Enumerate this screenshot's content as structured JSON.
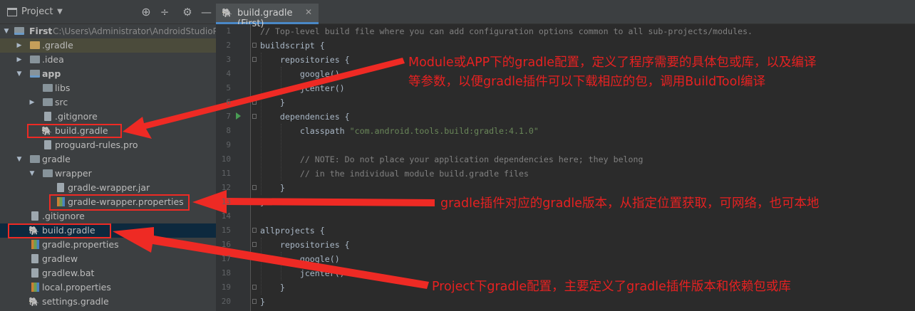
{
  "panel": {
    "title": "Project",
    "icons": [
      "target-icon",
      "collapse-icon",
      "gear-icon",
      "minimize-icon"
    ]
  },
  "tree": [
    {
      "label": "First",
      "path": "C:\\Users\\Administrator\\AndroidStudioP",
      "icon": "folder-module-icon",
      "expanded": true
    },
    {
      "label": ".gradle",
      "icon": "folder-icon",
      "expanded": false
    },
    {
      "label": ".idea",
      "icon": "folder-icon",
      "expanded": false
    },
    {
      "label": "app",
      "icon": "folder-module-icon",
      "expanded": true
    },
    {
      "label": "libs",
      "icon": "folder-icon"
    },
    {
      "label": "src",
      "icon": "folder-icon",
      "expanded": false
    },
    {
      "label": ".gitignore",
      "icon": "gitignore-file-icon"
    },
    {
      "label": "build.gradle",
      "icon": "gradle-elephant-icon"
    },
    {
      "label": "proguard-rules.pro",
      "icon": "file-icon"
    },
    {
      "label": "gradle",
      "icon": "folder-icon",
      "expanded": true
    },
    {
      "label": "wrapper",
      "icon": "folder-icon",
      "expanded": true
    },
    {
      "label": "gradle-wrapper.jar",
      "icon": "file-icon"
    },
    {
      "label": "gradle-wrapper.properties",
      "icon": "properties-file-icon"
    },
    {
      "label": ".gitignore",
      "icon": "gitignore-file-icon"
    },
    {
      "label": "build.gradle",
      "icon": "gradle-elephant-icon"
    },
    {
      "label": "gradle.properties",
      "icon": "properties-file-icon"
    },
    {
      "label": "gradlew",
      "icon": "file-icon"
    },
    {
      "label": "gradlew.bat",
      "icon": "file-icon"
    },
    {
      "label": "local.properties",
      "icon": "properties-file-icon"
    },
    {
      "label": "settings.gradle",
      "icon": "gradle-elephant-icon"
    }
  ],
  "editor": {
    "tab_label": "build.gradle (First)",
    "tab_close": "✕",
    "lines": [
      "// Top-level build file where you can add configuration options common to all sub-projects/modules.",
      "buildscript {",
      "    repositories {",
      "        google()",
      "        jcenter()",
      "    }",
      "    dependencies {",
      "        classpath \"com.android.tools.build:gradle:4.1.0\"",
      "",
      "        // NOTE: Do not place your application dependencies here; they belong",
      "        // in the individual module build.gradle files",
      "    }",
      "}",
      "",
      "allprojects {",
      "    repositories {",
      "        google()",
      "        jcenter()",
      "    }",
      "}"
    ]
  },
  "annotations": {
    "note1_line1": "Module或APP下的gradle配置，定义了程序需要的具体包或库，以及编译",
    "note1_line2": "等参数，以便gradle插件可以下载相应的包，调用BuildTool编译",
    "note2": "gradle插件对应的gradle版本，从指定位置获取，可网络，也可本地",
    "note3": "Project下gradle配置，主要定义了gradle插件版本和依赖包或库",
    "color": "#e62121"
  },
  "colors": {
    "panel_bg": "#3c3f41",
    "editor_bg": "#2b2b2b",
    "selection": "#0d293e",
    "comment": "#808080",
    "string": "#6a8759",
    "code": "#a9b7c6",
    "annotation_red": "#e62121"
  }
}
